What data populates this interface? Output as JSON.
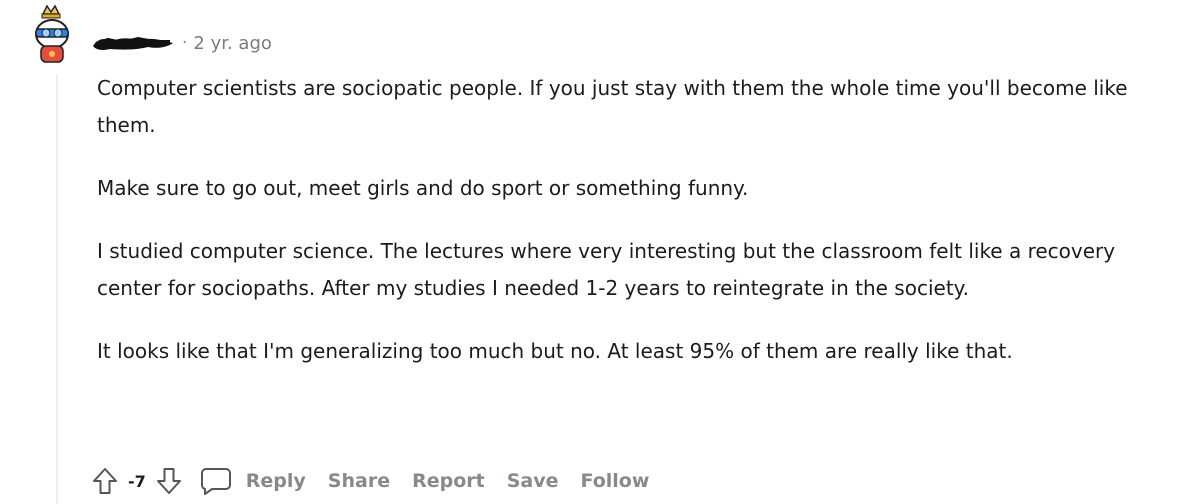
{
  "comment": {
    "timestamp": "2 yr. ago",
    "paragraphs": [
      "Computer scientists are sociopatic people. If you just stay with them the whole time you'll become like them.",
      "Make sure to go out, meet girls and do sport or something funny.",
      "I studied computer science. The lectures where very interesting but the classroom felt like a recovery center for sociopaths. After my studies I needed 1-2 years to reintegrate in the society.",
      "It looks like that I'm generalizing too much but no. At least 95% of them are really like that."
    ]
  },
  "actions": {
    "vote_count": "-7",
    "reply_label": "Reply",
    "share_label": "Share",
    "report_label": "Report",
    "save_label": "Save",
    "follow_label": "Follow"
  },
  "icons": {
    "avatar": "snoo-avatar",
    "upvote": "upvote-arrow-icon",
    "downvote": "downvote-arrow-icon",
    "reply": "comment-bubble-icon"
  },
  "colors": {
    "text": "#1c1c1c",
    "muted": "#878a8c",
    "thread_line": "#edeff1"
  }
}
